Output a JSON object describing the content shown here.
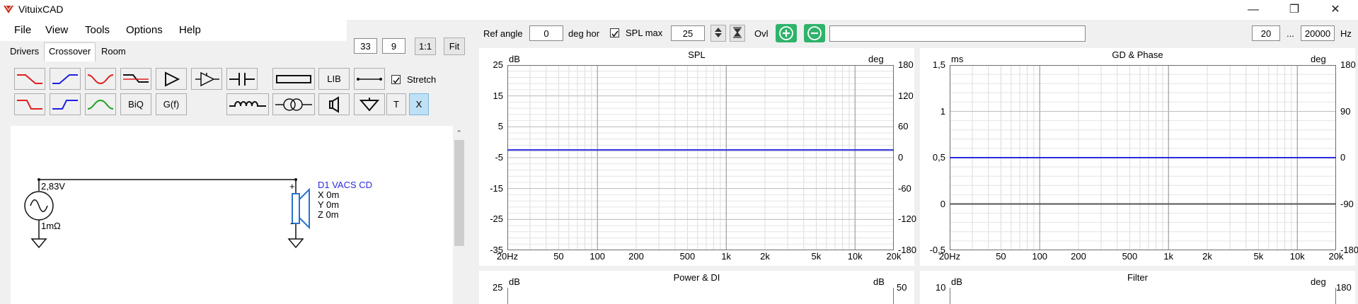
{
  "app": {
    "title": "VituixCAD"
  },
  "menu": {
    "items": [
      "File",
      "View",
      "Tools",
      "Options",
      "Help"
    ]
  },
  "topleft": {
    "val1": "33",
    "val2": "9",
    "btn_1to1": "1:1",
    "btn_fit": "Fit"
  },
  "tabs": [
    "Drivers",
    "Crossover",
    "Room"
  ],
  "toolbar": {
    "lib": "LIB",
    "biq": "BiQ",
    "gf": "G(f)",
    "t": "T",
    "x": "X",
    "stretch": "Stretch"
  },
  "schematic": {
    "source_voltage": "2,83V",
    "source_impedance": "1mΩ",
    "driver_name": "D1 VACS CD",
    "driver_x": "X 0m",
    "driver_y": "Y 0m",
    "driver_z": "Z 0m",
    "plus": "+",
    "minus": "-"
  },
  "topbar": {
    "ref_angle_label": "Ref angle",
    "ref_angle_value": "0",
    "deg_hor": "deg hor",
    "spl_max_label": "SPL max",
    "spl_max_value": "25",
    "ovl": "Ovl",
    "freq_min": "20",
    "ellipsis": "...",
    "freq_max": "20000",
    "hz": "Hz"
  },
  "charts": {
    "spl": {
      "title": "SPL",
      "left_unit": "dB",
      "right_unit": "deg",
      "left_ticks": [
        "25",
        "15",
        "5",
        "-5",
        "-15",
        "-25",
        "-35"
      ],
      "right_ticks": [
        "180",
        "120",
        "60",
        "0",
        "-60",
        "-120",
        "-180"
      ],
      "x_ticks": [
        "20Hz",
        "50",
        "100",
        "200",
        "500",
        "1k",
        "2k",
        "5k",
        "10k",
        "20k"
      ]
    },
    "gd": {
      "title": "GD & Phase",
      "left_unit": "ms",
      "right_unit": "deg",
      "left_ticks": [
        "1,5",
        "1",
        "0,5",
        "0",
        "-0,5"
      ],
      "right_ticks": [
        "180",
        "90",
        "0",
        "-90",
        "-180"
      ],
      "x_ticks": [
        "20Hz",
        "50",
        "100",
        "200",
        "500",
        "1k",
        "2k",
        "5k",
        "10k",
        "20k"
      ]
    },
    "power": {
      "title": "Power & DI",
      "left_unit": "dB",
      "right_unit": "dB",
      "left_top": "25",
      "right_top": "50"
    },
    "filter": {
      "title": "Filter",
      "left_unit": "dB",
      "right_unit": "deg",
      "left_top": "10",
      "right_top": "180"
    }
  },
  "chart_data": [
    {
      "type": "line",
      "title": "SPL",
      "xlabel": "",
      "ylabel": "dB",
      "x_scale": "log",
      "xlim": [
        20,
        20000
      ],
      "ylim": [
        -35,
        25
      ],
      "y2lim": [
        -180,
        180
      ],
      "series": [
        {
          "color": "#2a2adf",
          "x": [
            20,
            20000
          ],
          "y": [
            -2.5,
            -2.5
          ]
        }
      ],
      "grid": true
    },
    {
      "type": "line",
      "title": "GD & Phase",
      "xlabel": "",
      "ylabel": "ms",
      "x_scale": "log",
      "xlim": [
        20,
        20000
      ],
      "ylim": [
        -0.5,
        1.5
      ],
      "y2lim": [
        -180,
        180
      ],
      "series": [
        {
          "color": "#2a2adf",
          "x": [
            20,
            20000
          ],
          "y": [
            0.5,
            0.5
          ]
        },
        {
          "color": "#555555",
          "x": [
            20,
            20000
          ],
          "y": [
            0,
            0
          ]
        }
      ],
      "grid": true
    }
  ],
  "colors": {
    "accent_blue": "#2a2adf",
    "plus_green": "#2fb36a"
  }
}
